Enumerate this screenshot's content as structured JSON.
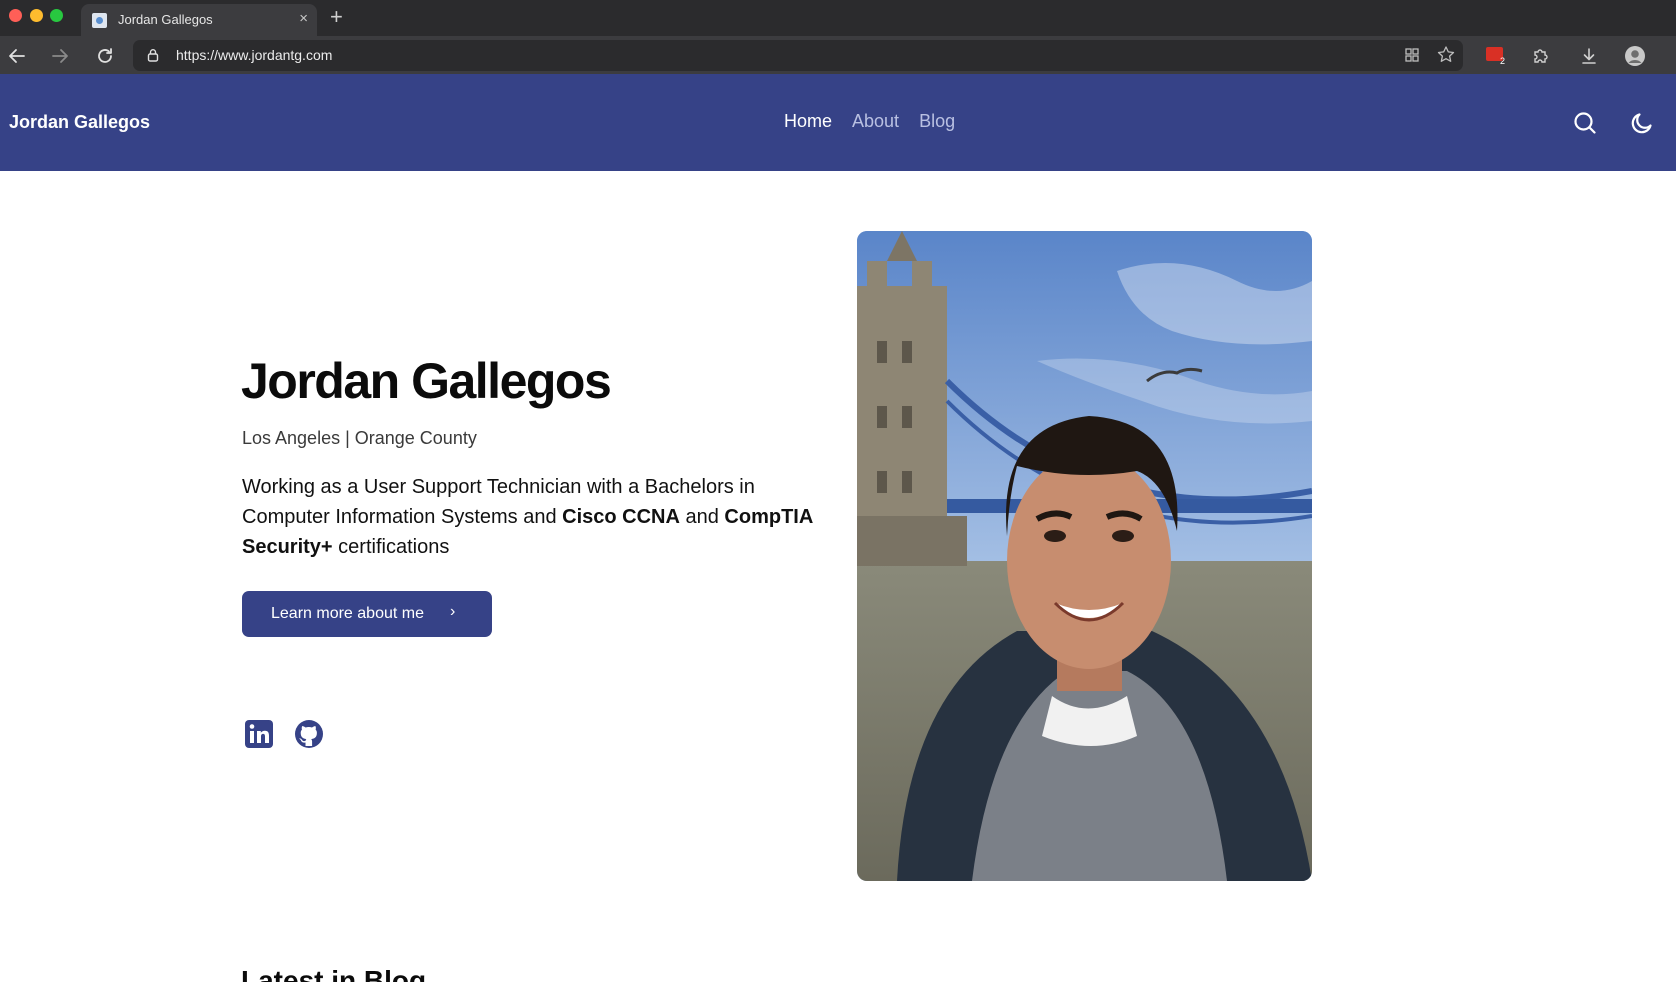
{
  "browser": {
    "tab_title": "Jordan Gallegos",
    "tab_close": "×",
    "new_tab": "+",
    "url": "https://www.jordantg.com",
    "extension_badge_count": "2"
  },
  "header": {
    "brand": "Jordan Gallegos",
    "nav": [
      {
        "label": "Home",
        "active": true
      },
      {
        "label": "About",
        "active": false
      },
      {
        "label": "Blog",
        "active": false
      }
    ],
    "icons": [
      "search-icon",
      "moon-icon"
    ]
  },
  "hero": {
    "title": "Jordan Gallegos",
    "location": "Los Angeles | Orange County",
    "desc_part1": "Working as a User Support Technician with a Bachelors in Computer Information Systems and ",
    "desc_bold1": "Cisco CCNA",
    "desc_part2": " and ",
    "desc_bold2": "CompTIA Security+",
    "desc_part3": " certifications",
    "cta_label": "Learn more about me",
    "cta_chevron": "›",
    "social": [
      "linkedin-icon",
      "github-icon"
    ],
    "photo": "portrait-photo"
  },
  "blog": {
    "heading": "Latest in Blog"
  },
  "colors": {
    "brand": "#364287",
    "chrome_dark": "#2b2b2d",
    "chrome_toolbar": "#3c3c3f"
  }
}
